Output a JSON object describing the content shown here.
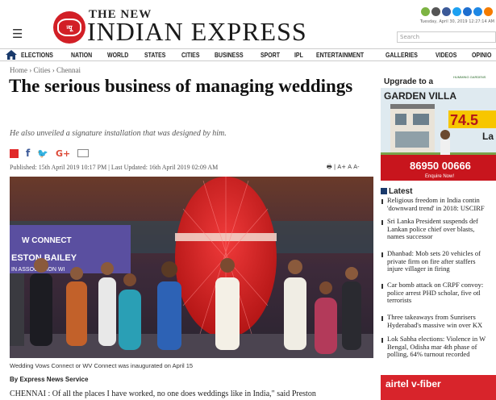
{
  "header": {
    "logo_the": "THE NEW",
    "logo_main": "INDIAN EXPRESS",
    "dateline": "Tuesday, April 30, 2019  12:27:14 AM",
    "search_placeholder": "Search"
  },
  "nav": {
    "items": [
      "ELECTIONS",
      "NATION",
      "WORLD",
      "STATES",
      "CITIES",
      "BUSINESS",
      "SPORT",
      "IPL",
      "ENTERTAINMENT",
      "GALLERIES",
      "VIDEOS",
      "OPINIO"
    ]
  },
  "article": {
    "breadcrumb": "Home › Cities › Chennai",
    "headline": "The serious business of managing weddings",
    "subhead": "He also unveiled a signature installation that was designed by him.",
    "meta": "Published: 15th April 2019 10:17 PM  |  Last Updated: 16th April 2019 02:09 AM",
    "tools": "🖶 |  A+ A  A-",
    "banner_logo": "W CONNECT",
    "banner_text": "ESTON BAILEY",
    "banner_text2": "IN ASSOCIATION WI",
    "caption": "Wedding Vows Connect or WV Connect was inaugurated on April 15",
    "byline": "By Express News Service",
    "body_start": "CHENNAI : Of all the places I have worked, no one does weddings like in India,\" said Preston"
  },
  "sidebar": {
    "ad_top": {
      "upgrade": "Upgrade to a",
      "brand": "HUMMING GARDENS",
      "headline": "GARDEN VILLA",
      "price": "74.5",
      "price_suffix": "La",
      "phone": "86950 00666",
      "cta": "Enquire Now!"
    },
    "latest_title": "Latest",
    "latest": [
      "Religious freedom in India contin\n'downward trend' in 2018: USCIRF",
      "Sri Lanka President suspends def\nLankan police chief over blasts,\nnames successor",
      "Dhanbad: Mob sets 20 vehicles of\nprivate firm on fire after staffers\ninjure villager in firing",
      "Car bomb attack on CRPF convoy:\npolice arrest PHD scholar, five otl\nterrorists",
      "Three takeaways from Sunrisers\nHyderabad's massive win over KX",
      "Lok Sabha elections: Violence in W\nBengal, Odisha mar 4th phase of\npolling, 64% turnout recorded"
    ],
    "ad_bottom": "airtel v-fiber"
  },
  "colors": {
    "brand_red": "#d21f26",
    "nav_border": "#cccccc",
    "price_yellow": "#f7c600"
  }
}
